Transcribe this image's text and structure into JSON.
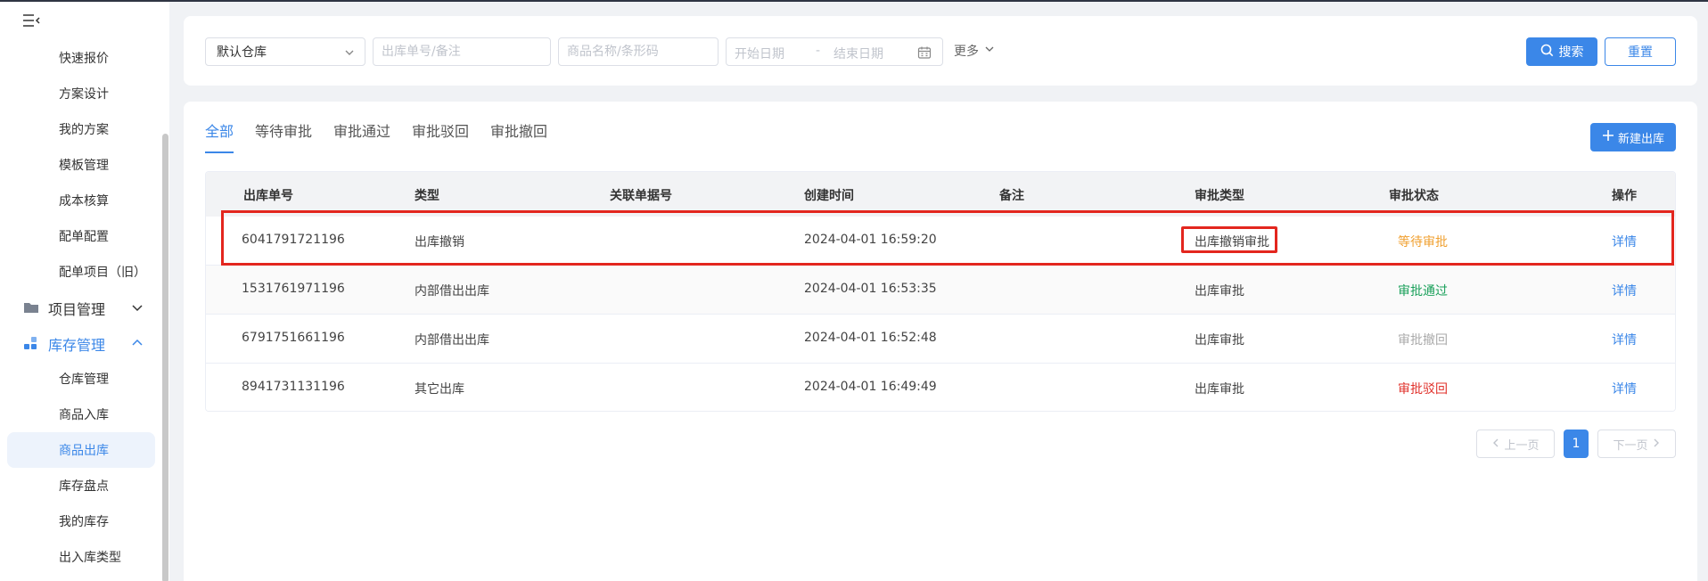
{
  "sidebar": {
    "items": [
      {
        "label": "快速报价"
      },
      {
        "label": "方案设计"
      },
      {
        "label": "我的方案"
      },
      {
        "label": "模板管理"
      },
      {
        "label": "成本核算"
      },
      {
        "label": "配单配置"
      },
      {
        "label": "配单项目（旧）"
      }
    ],
    "groups": [
      {
        "label": "项目管理",
        "icon": "folder-icon"
      },
      {
        "label": "库存管理",
        "icon": "inventory-icon"
      }
    ],
    "inventory_items": [
      {
        "label": "仓库管理"
      },
      {
        "label": "商品入库"
      },
      {
        "label": "商品出库",
        "active": true
      },
      {
        "label": "库存盘点"
      },
      {
        "label": "我的库存"
      },
      {
        "label": "出入库类型"
      }
    ]
  },
  "filters": {
    "warehouse_value": "默认仓库",
    "order_placeholder": "出库单号/备注",
    "product_placeholder": "商品名称/条形码",
    "start_date_placeholder": "开始日期",
    "date_separator": "-",
    "end_date_placeholder": "结束日期",
    "more_label": "更多",
    "search_label": "搜索",
    "reset_label": "重置"
  },
  "tabs": [
    "全部",
    "等待审批",
    "审批通过",
    "审批驳回",
    "审批撤回"
  ],
  "new_button_label": "新建出库",
  "table": {
    "headers": [
      "出库单号",
      "类型",
      "关联单据号",
      "创建时间",
      "备注",
      "审批类型",
      "审批状态",
      "操作"
    ],
    "rows": [
      {
        "order_no": "6041791721196",
        "type": "出库撤销",
        "related": "",
        "created": "2024-04-01 16:59:20",
        "note": "",
        "approval_type": "出库撤销审批",
        "status": "等待审批",
        "status_color": "#f0a030",
        "action": "详情"
      },
      {
        "order_no": "1531761971196",
        "type": "内部借出出库",
        "related": "",
        "created": "2024-04-01 16:53:35",
        "note": "",
        "approval_type": "出库审批",
        "status": "审批通过",
        "status_color": "#1aa05a",
        "action": "详情"
      },
      {
        "order_no": "6791751661196",
        "type": "内部借出出库",
        "related": "",
        "created": "2024-04-01 16:52:48",
        "note": "",
        "approval_type": "出库审批",
        "status": "审批撤回",
        "status_color": "#aaaaaa",
        "action": "详情"
      },
      {
        "order_no": "8941731131196",
        "type": "其它出库",
        "related": "",
        "created": "2024-04-01 16:49:49",
        "note": "",
        "approval_type": "出库审批",
        "status": "审批驳回",
        "status_color": "#e0302a",
        "action": "详情"
      }
    ]
  },
  "pagination": {
    "prev_label": "上一页",
    "current": "1",
    "next_label": "下一页"
  },
  "colors": {
    "accent": "#3b87e8",
    "highlight": "#e3261e"
  }
}
